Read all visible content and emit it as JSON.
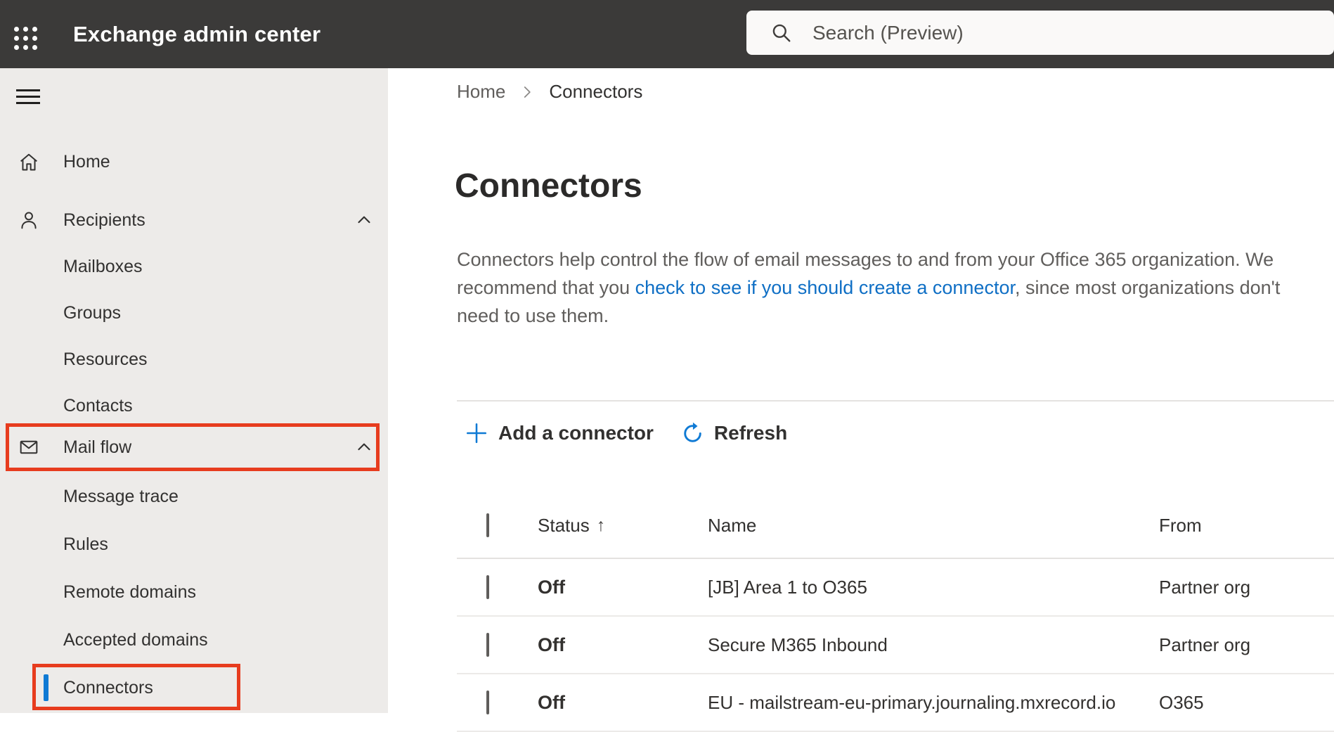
{
  "colors": {
    "topbar_bg": "#3b3a39",
    "sidebar_bg": "#edebe9",
    "accent_blue": "#0f7ad4",
    "link_blue": "#0f6fc5",
    "annotation_red": "#e73c1e",
    "selected_indicator_blue": "#0f7ad4"
  },
  "topbar": {
    "app_title": "Exchange admin center",
    "search_placeholder": "Search (Preview)"
  },
  "sidebar": {
    "items": [
      {
        "label": "Home"
      },
      {
        "label": "Recipients"
      },
      {
        "label": "Mailboxes"
      },
      {
        "label": "Groups"
      },
      {
        "label": "Resources"
      },
      {
        "label": "Contacts"
      },
      {
        "label": "Mail flow"
      },
      {
        "label": "Message trace"
      },
      {
        "label": "Rules"
      },
      {
        "label": "Remote domains"
      },
      {
        "label": "Accepted domains"
      },
      {
        "label": "Connectors"
      }
    ]
  },
  "breadcrumb": {
    "parent": "Home",
    "current": "Connectors"
  },
  "page": {
    "title": "Connectors",
    "intro_before": "Connectors help control the flow of email messages to and from your Office 365 organization. We recommend that you ",
    "intro_link": "check to see if you should create a connector",
    "intro_after": ", since most organizations don't need to use them."
  },
  "toolbar": {
    "add_button": "Add a connector",
    "refresh_button": "Refresh"
  },
  "table": {
    "headers": {
      "status": "Status",
      "name": "Name",
      "from": "From",
      "sort_icon": "↑"
    },
    "rows": [
      {
        "status": "Off",
        "name": "[JB] Area 1 to O365",
        "from": "Partner org"
      },
      {
        "status": "Off",
        "name": "Secure M365 Inbound",
        "from": "Partner org"
      },
      {
        "status": "Off",
        "name": "EU - mailstream-eu-primary.journaling.mxrecord.io",
        "from": "O365"
      }
    ]
  }
}
